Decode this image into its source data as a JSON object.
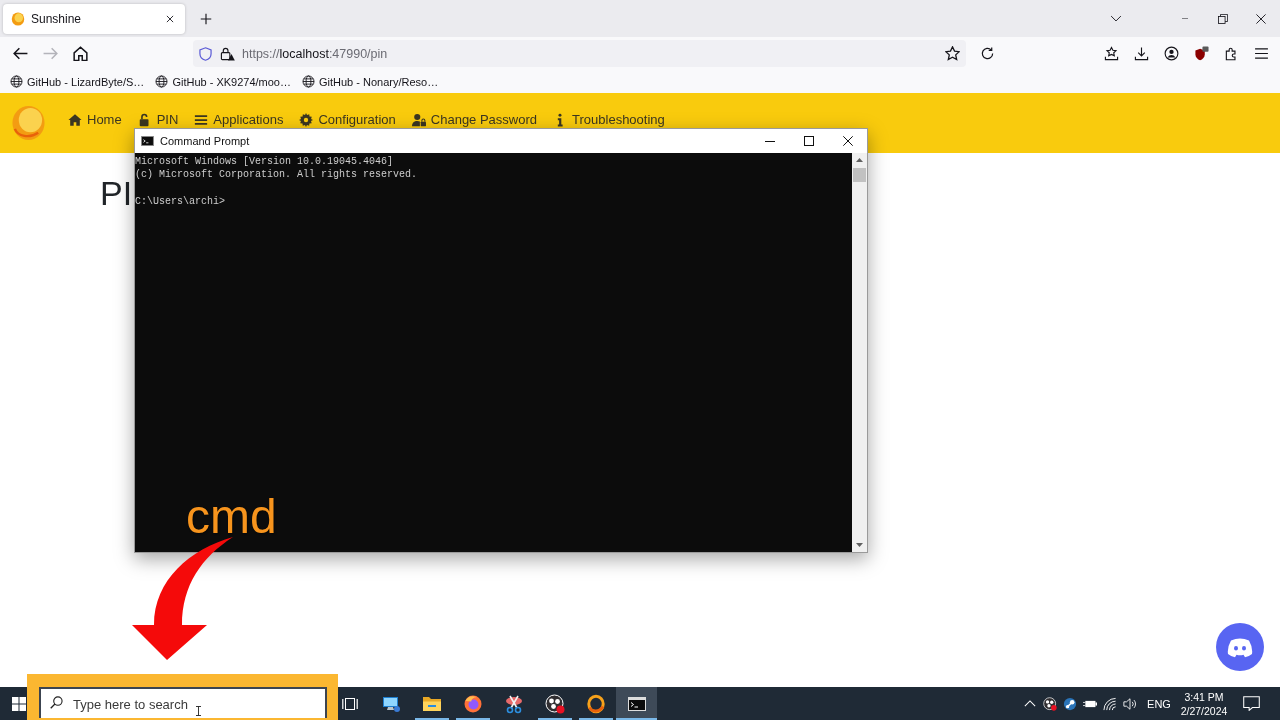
{
  "browser": {
    "tabs": [
      {
        "title": "Sunshine",
        "selected": true
      }
    ],
    "nav_buttons": [
      {
        "kind": "back",
        "disabled": false
      },
      {
        "kind": "forward",
        "disabled": true
      },
      {
        "kind": "home",
        "disabled": false
      }
    ],
    "address": {
      "scheme": "https://",
      "host": "localhost",
      "path": ":47990/pin"
    },
    "bookmarks": [
      "GitHub - LizardByte/S…",
      "GitHub - XK9274/moo…",
      "GitHub - Nonary/Reso…"
    ]
  },
  "page": {
    "nav": [
      {
        "label": "Home",
        "kind": "home"
      },
      {
        "label": "PIN",
        "kind": "pin"
      },
      {
        "label": "Applications",
        "kind": "applications"
      },
      {
        "label": "Configuration",
        "kind": "configuration"
      },
      {
        "label": "Change Password",
        "kind": "password"
      },
      {
        "label": "Troubleshooting",
        "kind": "troubleshooting"
      }
    ],
    "heading": "PI"
  },
  "console": {
    "title": "Command Prompt",
    "output": [
      "Microsoft Windows [Version 10.0.19045.4046]",
      "(c) Microsoft Corporation. All rights reserved."
    ],
    "prompt": "C:\\Users\\archi>"
  },
  "annotation": {
    "label": "cmd",
    "highlight_search": true
  },
  "taskbar": {
    "search": {
      "placeholder": "Type here to search"
    },
    "apps": [
      {
        "kind": "monitor",
        "running": false,
        "selected": false
      },
      {
        "kind": "folder",
        "running": true,
        "selected": false
      },
      {
        "kind": "browser",
        "running": true,
        "selected": false
      },
      {
        "kind": "scissors",
        "running": false,
        "selected": false
      },
      {
        "kind": "recorder",
        "running": true,
        "selected": false
      },
      {
        "kind": "ring",
        "running": true,
        "selected": false
      },
      {
        "kind": "terminal",
        "running": true,
        "selected": true
      }
    ],
    "tray": {
      "language": "ENG",
      "time": "3:41 PM",
      "date": "2/27/2024"
    }
  }
}
